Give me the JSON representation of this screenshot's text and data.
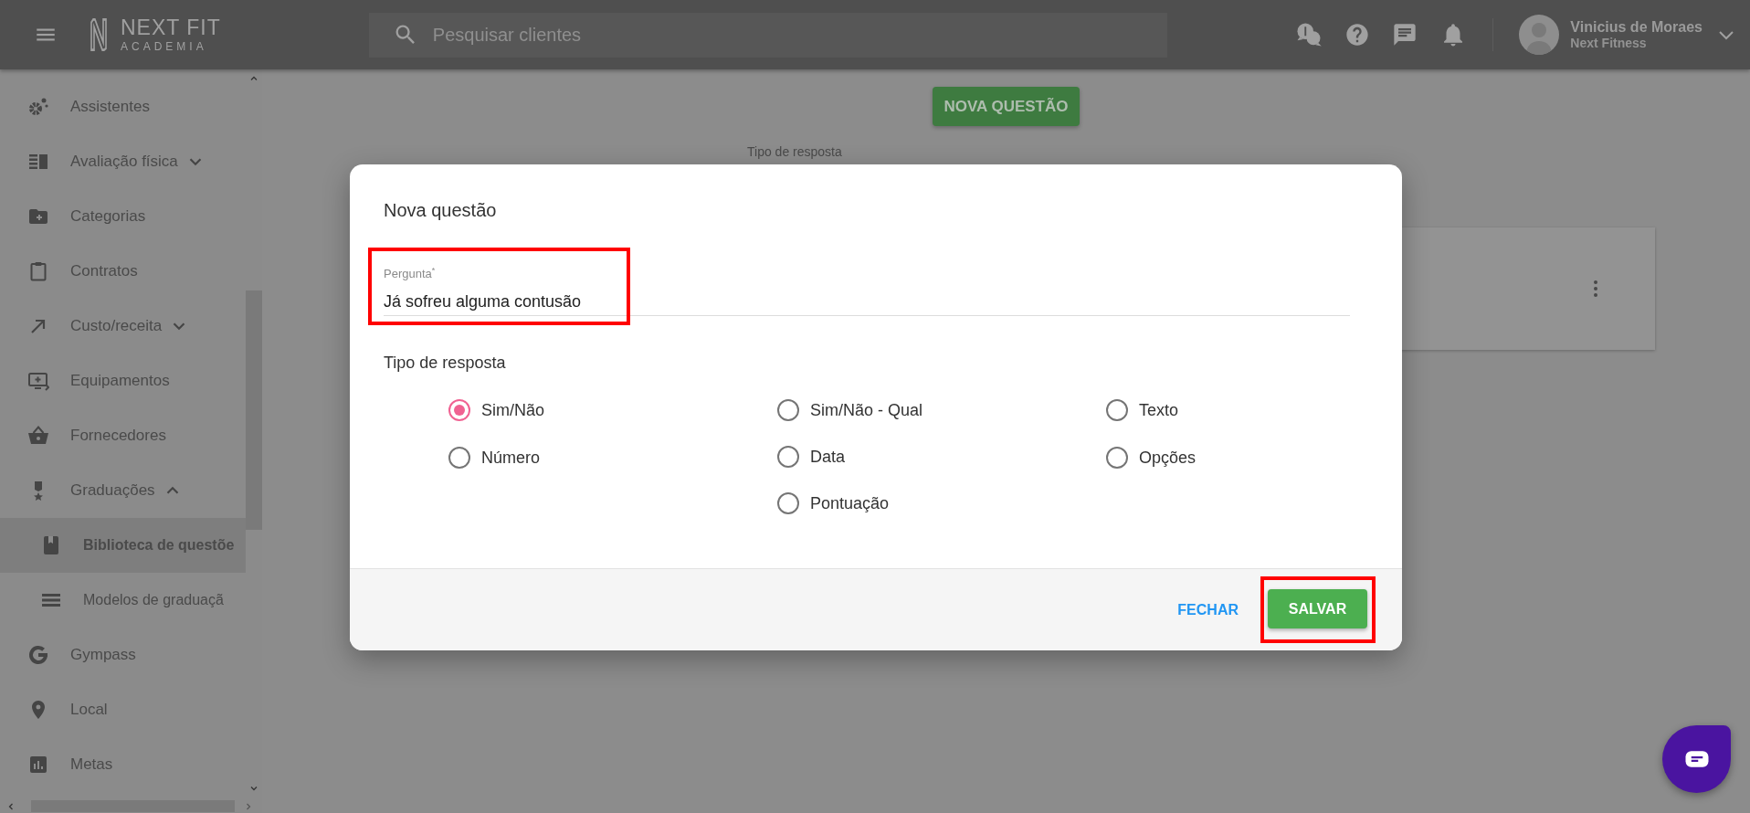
{
  "top_bar": {
    "logo": {
      "name": "NEXT FIT",
      "subtitle": "ACADEMIA"
    },
    "search": {
      "placeholder": "Pesquisar clientes"
    },
    "user": {
      "name": "Vinicius de Moraes",
      "company": "Next Fitness"
    }
  },
  "sidebar": {
    "items": [
      {
        "label": "Assistentes",
        "selected": false
      },
      {
        "label": "Avaliação física",
        "selected": false,
        "expanded": false
      },
      {
        "label": "Categorias",
        "selected": false
      },
      {
        "label": "Contratos",
        "selected": false
      },
      {
        "label": "Custo/receita",
        "selected": false,
        "expanded": false
      },
      {
        "label": "Equipamentos",
        "selected": false
      },
      {
        "label": "Fornecedores",
        "selected": false
      },
      {
        "label": "Graduações",
        "selected": false,
        "expanded": true,
        "children": [
          {
            "label": "Biblioteca de questõe",
            "selected": true
          },
          {
            "label": "Modelos de graduaçã",
            "selected": false
          }
        ]
      },
      {
        "label": "Gympass",
        "selected": false
      },
      {
        "label": "Local",
        "selected": false
      },
      {
        "label": "Metas",
        "selected": false
      }
    ]
  },
  "page": {
    "new_question_button": "NOVA QUESTÃO",
    "filter_label": "Tipo de resposta"
  },
  "dialog": {
    "title": "Nova questão",
    "question": {
      "label": "Pergunta$^{*}$",
      "value": "Já sofreu alguma contusão",
      "highlighted": true
    },
    "answer_type": {
      "label": "Tipo de resposta",
      "columns": [
        {
          "options": [
            {
              "label": "Sim/Não",
              "selected": true
            },
            {
              "label": "Número",
              "selected": false
            }
          ]
        },
        {
          "options": [
            {
              "label": "Sim/Não - Qual",
              "selected": false
            },
            {
              "label": "Data",
              "selected": false
            },
            {
              "label": "Pontuação",
              "selected": false
            }
          ]
        },
        {
          "options": [
            {
              "label": "Texto",
              "selected": false
            },
            {
              "label": "Opções",
              "selected": false
            }
          ]
        }
      ]
    },
    "buttons": [
      {
        "label": "FECHAR",
        "kind": "flat",
        "highlighted": false
      },
      {
        "label": "SALVAR",
        "kind": "raised",
        "highlighted": true
      }
    ]
  }
}
